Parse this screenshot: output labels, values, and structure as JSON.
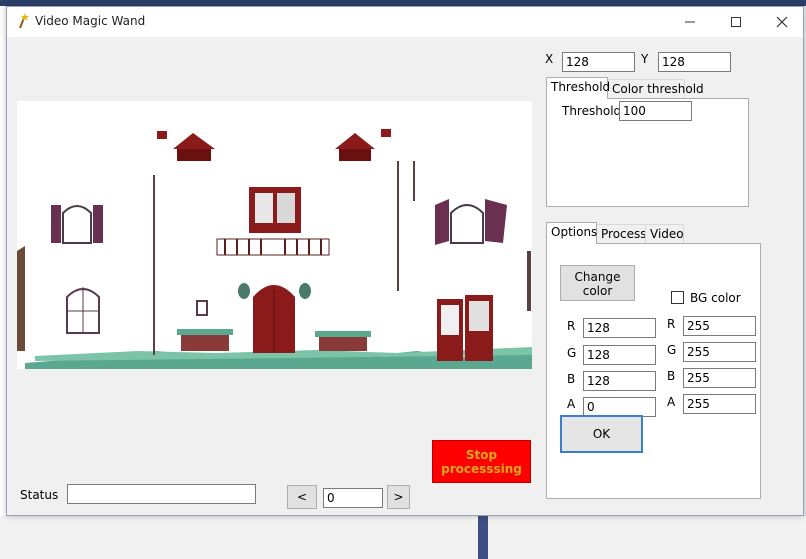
{
  "window": {
    "title": "Video Magic Wand"
  },
  "coords": {
    "x_label": "X",
    "x_value": "128",
    "y_label": "Y",
    "y_value": "128"
  },
  "threshold_tabs": {
    "tabs": [
      "Threshold",
      "Color threshold"
    ],
    "threshold_label": "Threshold",
    "threshold_value": "100"
  },
  "options_tabs": {
    "tabs": [
      "Options",
      "Process",
      "Video"
    ]
  },
  "options": {
    "change_color_label_1": "Change",
    "change_color_label_2": "color",
    "bg_color_label": "BG color",
    "fg": {
      "r_label": "R",
      "r": "128",
      "g_label": "G",
      "g": "128",
      "b_label": "B",
      "b": "128",
      "a_label": "A",
      "a": "0"
    },
    "bg": {
      "r_label": "R",
      "r": "255",
      "g_label": "G",
      "g": "255",
      "b_label": "B",
      "b": "255",
      "a_label": "A",
      "a": "255"
    },
    "ok_label": "OK"
  },
  "stop_button": {
    "line1": "Stop",
    "line2": "processsing"
  },
  "status": {
    "label": "Status",
    "value": ""
  },
  "frame_nav": {
    "prev": "<",
    "frame": "0",
    "next": ">"
  },
  "colors": {
    "stop_bg": "#ff0000",
    "stop_text": "#d9a81a",
    "ok_border": "#3a7fd0",
    "house_red": "#8b1a1a",
    "snow_green": "#5aa88f"
  },
  "icons": {
    "app": "wand-icon",
    "minimize": "minimize-icon",
    "maximize": "maximize-icon",
    "close": "close-icon"
  }
}
